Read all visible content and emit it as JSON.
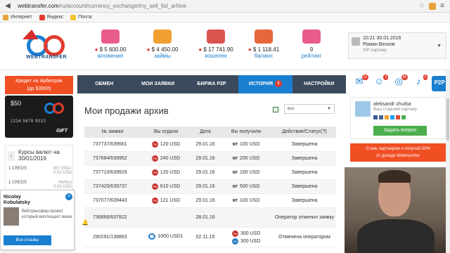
{
  "browser": {
    "url_host": "webtransfer.com",
    "url_path": "/ru/account/currency_exchange/my_sell_list_arhive",
    "bookmarks": [
      "Интернет",
      "Яндекс",
      "Почта"
    ]
  },
  "header": {
    "brand": "WEBTRANSFER",
    "stats": [
      {
        "value": "$ 5 600.00",
        "label": "вложения",
        "icon": "piggy-bank-icon"
      },
      {
        "value": "$ 4 450.00",
        "label": "займы",
        "icon": "money-bag-icon"
      },
      {
        "value": "$ 17 741.90",
        "label": "кошелек",
        "icon": "wallet-icon"
      },
      {
        "value": "$ 1 118.41",
        "label": "баланс",
        "icon": "building-icon"
      },
      {
        "value": "9",
        "label": "рейтинг",
        "icon": "thumbs-up-icon"
      }
    ],
    "user": {
      "datetime": "10:21 30.01.2016",
      "name": "Роман Весков",
      "status": "VIP партнер"
    }
  },
  "left": {
    "credit_line1": "Кредит на Арбитраж",
    "credit_line2": "(до $3000)",
    "card": {
      "amount": "$50",
      "number": "1234 5678 9010",
      "tag": "GIFT"
    },
    "rates": {
      "title_line1": "Курсы валют на",
      "title_line2": "30/01/2016",
      "rows": [
        {
          "left": "1 CREDS",
          "right_line1": "WT VISA:",
          "right_line2": "0.02 USD"
        },
        {
          "left": "1 CREDS",
          "right_line1": "Perfect",
          "right_line2": "0.02 USD"
        }
      ]
    }
  },
  "review": {
    "name_line1": "Nicolay",
    "name_line2": "Kobulatsky",
    "text": "Вебтрансфер-проект который воплощает ваши",
    "button": "Все отзывы"
  },
  "tabs": [
    {
      "label": "ОБМЕН",
      "active": false
    },
    {
      "label": "МОИ ЗАЯВКИ",
      "active": false
    },
    {
      "label": "БИРЖА P2P",
      "active": false
    },
    {
      "label": "ИСТОРИЯ",
      "active": true,
      "badge": "1"
    },
    {
      "label": "НАСТРОЙКИ",
      "active": false
    }
  ],
  "main": {
    "title": "Мои продажи архив",
    "filter_value": "все",
    "columns": [
      "№ заявки",
      "Вы отдали",
      "Дата",
      "Вы получили",
      "Действие/Статус(?)"
    ],
    "rows": [
      {
        "id": "737737/639561",
        "gave": "120 USD",
        "gave_icon": "PM",
        "date": "29.01.16",
        "received": [
          "100 USD"
        ],
        "status": "Завершена"
      },
      {
        "id": "737684/639952",
        "gave": "240 USD",
        "gave_icon": "PM",
        "date": "29.01.16",
        "received": [
          "200 USD"
        ],
        "status": "Завершена"
      },
      {
        "id": "737710/639929",
        "gave": "120 USD",
        "gave_icon": "PM",
        "date": "29.01.16",
        "received": [
          "100 USD"
        ],
        "status": "Завершена"
      },
      {
        "id": "737420/639737",
        "gave": "610 USD",
        "gave_icon": "PM",
        "date": "29.01.16",
        "received": [
          "500 USD"
        ],
        "status": "Завершена"
      },
      {
        "id": "737077/639443",
        "gave": "121 USD",
        "gave_icon": "PM",
        "date": "29.01.16",
        "received": [
          "100 USD"
        ],
        "status": "Завершена"
      },
      {
        "id": "736866/637822",
        "gave": "",
        "gave_icon": "",
        "date": "28.01.16",
        "received": [
          ""
        ],
        "status": "Оператор отменил заявку",
        "bell": true
      },
      {
        "id": "290291/138863",
        "gave": "1000 USD1",
        "gave_icon": "WT",
        "date": "02.11.15",
        "received": [
          "300 USD",
          "300 USD"
        ],
        "status": "Отменена оператором"
      }
    ]
  },
  "right": {
    "icons": [
      {
        "name": "mail-icon",
        "badge": "12"
      },
      {
        "name": "users-icon",
        "badge": "3"
      },
      {
        "name": "globe-icon",
        "badge": "85"
      },
      {
        "name": "bell-icon",
        "badge": "2"
      },
      {
        "name": "p2p-icon",
        "badge": "",
        "label": "P2P"
      }
    ],
    "partner": {
      "name": "aleksandr zhurba",
      "role": "Ваш старший партнер",
      "button": "Задать вопрос"
    },
    "promo_line1": "Стань партнером и получай 50%",
    "promo_line2": "от дохода Webtransfer"
  },
  "colors": {
    "accent": "#1b7fd0",
    "orange": "#f04e23",
    "tabbar": "#3a4a5c",
    "green": "#4cae4c"
  }
}
